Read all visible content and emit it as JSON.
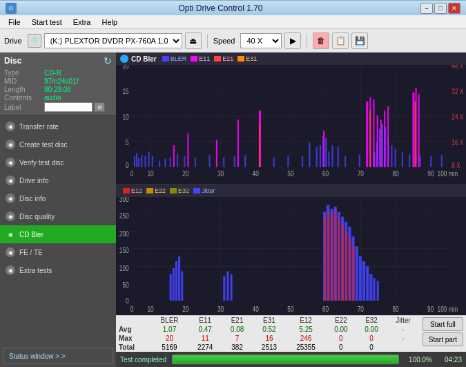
{
  "titlebar": {
    "icon": "⊙",
    "title": "Opti Drive Control 1.70",
    "minimize": "−",
    "maximize": "□",
    "close": "✕"
  },
  "menubar": {
    "items": [
      "File",
      "Start test",
      "Extra",
      "Help"
    ]
  },
  "toolbar": {
    "drive_label": "Drive",
    "drive_value": "(K:)  PLEXTOR DVDR  PX-760A 1.07",
    "speed_label": "Speed",
    "speed_value": "40 X"
  },
  "disc": {
    "title": "Disc",
    "type_label": "Type",
    "type_value": "CD-R",
    "mid_label": "MID",
    "mid_value": "97m24s01f",
    "length_label": "Length",
    "length_value": "80:29.06",
    "contents_label": "Contents",
    "contents_value": "audio",
    "label_label": "Label",
    "label_value": ""
  },
  "sidebar_nav": [
    {
      "id": "transfer-rate",
      "label": "Transfer rate",
      "active": false
    },
    {
      "id": "create-test-disc",
      "label": "Create test disc",
      "active": false
    },
    {
      "id": "verify-test-disc",
      "label": "Verify test disc",
      "active": false
    },
    {
      "id": "drive-info",
      "label": "Drive info",
      "active": false
    },
    {
      "id": "disc-info",
      "label": "Disc info",
      "active": false
    },
    {
      "id": "disc-quality",
      "label": "Disc quality",
      "active": false
    },
    {
      "id": "cd-bler",
      "label": "CD Bler",
      "active": true
    },
    {
      "id": "fe-te",
      "label": "FE / TE",
      "active": false
    },
    {
      "id": "extra-tests",
      "label": "Extra tests",
      "active": false
    }
  ],
  "status_window": "Status window > >",
  "chart1": {
    "title": "CD Bler",
    "legend": [
      {
        "label": "BLER",
        "color": "#4444ff"
      },
      {
        "label": "E11",
        "color": "#ff00ff"
      },
      {
        "label": "E21",
        "color": "#ff4444"
      },
      {
        "label": "E31",
        "color": "#884400"
      }
    ],
    "y_left": [
      "20",
      "15",
      "10",
      "5",
      "0"
    ],
    "y_right": [
      "48 X",
      "32 X",
      "24 X",
      "16 X",
      "8 X"
    ],
    "x_labels": [
      "0",
      "10",
      "20",
      "30",
      "40",
      "50",
      "60",
      "70",
      "80",
      "90",
      "100 min"
    ]
  },
  "chart2": {
    "legend": [
      {
        "label": "E12",
        "color": "#dd2222"
      },
      {
        "label": "E22",
        "color": "#aa6600"
      },
      {
        "label": "E32",
        "color": "#888800"
      },
      {
        "label": "Jitter",
        "color": "#4444ff"
      }
    ],
    "y_left": [
      "300",
      "250",
      "200",
      "150",
      "100",
      "50",
      "0"
    ],
    "x_labels": [
      "0",
      "10",
      "20",
      "30",
      "40",
      "50",
      "60",
      "70",
      "80",
      "90",
      "100 min"
    ]
  },
  "stats": {
    "headers": [
      "",
      "BLER",
      "E11",
      "E21",
      "E31",
      "E12",
      "E22",
      "E32",
      "Jitter"
    ],
    "rows": [
      {
        "label": "Avg",
        "values": [
          "1.07",
          "0.47",
          "0.08",
          "0.52",
          "5.25",
          "0.00",
          "0.00",
          "-"
        ]
      },
      {
        "label": "Max",
        "values": [
          "20",
          "11",
          "7",
          "16",
          "246",
          "0",
          "0",
          "-"
        ]
      },
      {
        "label": "Total",
        "values": [
          "5169",
          "2274",
          "382",
          "2513",
          "25355",
          "0",
          "0",
          ""
        ]
      }
    ],
    "start_full": "Start full",
    "start_part": "Start part"
  },
  "progress": {
    "status": "Test completed",
    "percent": "100.0%",
    "fill_width": "100",
    "time": "04:23"
  }
}
